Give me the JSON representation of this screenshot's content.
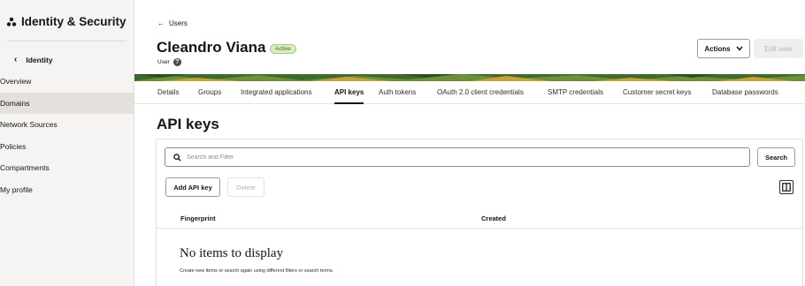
{
  "sidebar": {
    "title": "Identity & Security",
    "back_label": "Identity",
    "items": [
      {
        "label": "Overview"
      },
      {
        "label": "Domains"
      },
      {
        "label": "Network Sources"
      },
      {
        "label": "Policies"
      },
      {
        "label": "Compartments"
      },
      {
        "label": "My profile"
      }
    ],
    "active_item": "Domains"
  },
  "header": {
    "back_link": "Users",
    "user_name": "Cleandro Viana",
    "status": "Active",
    "user_type": "User",
    "actions_label": "Actions",
    "edit_label": "Edit user"
  },
  "tabs": [
    {
      "label": "Details"
    },
    {
      "label": "Groups"
    },
    {
      "label": "Integrated applications"
    },
    {
      "label": "API keys"
    },
    {
      "label": "Auth tokens"
    },
    {
      "label": "OAuth 2.0 client credentials"
    },
    {
      "label": "SMTP credentials"
    },
    {
      "label": "Customer secret keys"
    },
    {
      "label": "Database passwords"
    }
  ],
  "active_tab": "API keys",
  "content": {
    "title": "API keys",
    "search_placeholder": "Search and Filter",
    "search_button": "Search",
    "add_button": "Add API key",
    "delete_button": "Delete",
    "columns": [
      "Fingerprint",
      "Created"
    ],
    "empty_title": "No items to display",
    "empty_subtitle": "Create new items or search again using different filters or search terms."
  },
  "colors": {
    "sidebar_bg": "#f5f4f2",
    "active_badge_bg": "#d9ecc2",
    "banner_green": "#3f6a2e"
  }
}
